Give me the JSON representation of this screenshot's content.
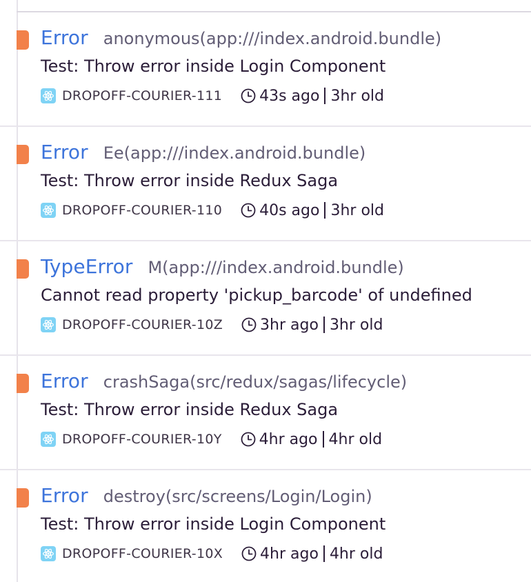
{
  "colors": {
    "level_error": "#f2814a",
    "type_link": "#3d74db"
  },
  "issues": [
    {
      "type": "Error",
      "location": "anonymous(app:///index.android.bundle)",
      "message": "Test: Throw error inside Login Component",
      "issue_id": "DROPOFF-COURIER-111",
      "last_seen": "43s ago",
      "first_seen": "3hr old",
      "project_icon": "react-icon",
      "level": "error"
    },
    {
      "type": "Error",
      "location": "Ee(app:///index.android.bundle)",
      "message": "Test: Throw error inside Redux Saga",
      "issue_id": "DROPOFF-COURIER-110",
      "last_seen": "40s ago",
      "first_seen": "3hr old",
      "project_icon": "react-icon",
      "level": "error"
    },
    {
      "type": "TypeError",
      "location": "M(app:///index.android.bundle)",
      "message": "Cannot read property 'pickup_barcode' of undefined",
      "issue_id": "DROPOFF-COURIER-10Z",
      "last_seen": "3hr ago",
      "first_seen": "3hr old",
      "project_icon": "react-icon",
      "level": "error"
    },
    {
      "type": "Error",
      "location": "crashSaga(src/redux/sagas/lifecycle)",
      "message": "Test: Throw error inside Redux Saga",
      "issue_id": "DROPOFF-COURIER-10Y",
      "last_seen": "4hr ago",
      "first_seen": "4hr old",
      "project_icon": "react-icon",
      "level": "error"
    },
    {
      "type": "Error",
      "location": "destroy(src/screens/Login/Login)",
      "message": "Test: Throw error inside Login Component",
      "issue_id": "DROPOFF-COURIER-10X",
      "last_seen": "4hr ago",
      "first_seen": "4hr old",
      "project_icon": "react-icon",
      "level": "error"
    }
  ]
}
